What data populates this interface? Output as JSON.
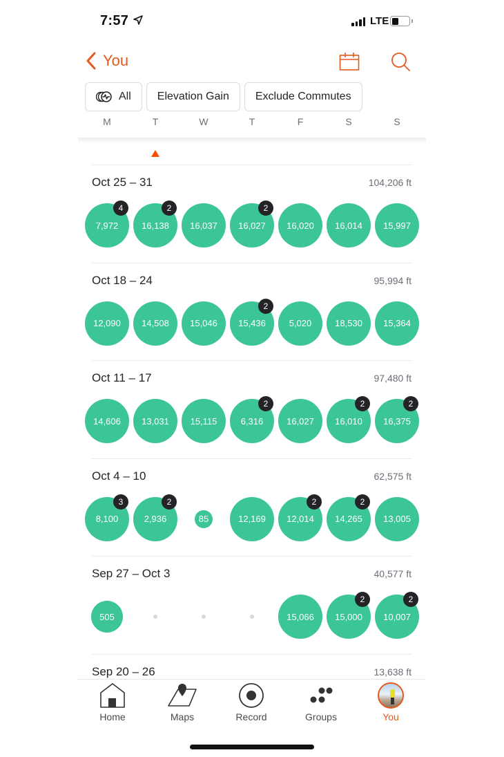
{
  "status_bar": {
    "time": "7:57",
    "network": "LTE",
    "battery_percent": 30
  },
  "nav": {
    "back_label": "You",
    "icons": [
      "chevron-left-icon",
      "calendar-icon",
      "search-icon"
    ]
  },
  "filters": [
    {
      "label": "All",
      "icon": "sport-types-icon"
    },
    {
      "label": "Elevation Gain"
    },
    {
      "label": "Exclude Commutes"
    }
  ],
  "days": [
    "M",
    "T",
    "W",
    "T",
    "F",
    "S",
    "S"
  ],
  "today_index": 1,
  "colors": {
    "accent": "#fc4c02",
    "activity": "#3cc597",
    "badge": "#242428"
  },
  "unit": "ft",
  "weeks": [
    {
      "range": "Oct 25 – 31",
      "total": "104,206 ft",
      "days": [
        {
          "value": "7,972",
          "count": "4"
        },
        {
          "value": "16,138",
          "count": "2"
        },
        {
          "value": "16,037"
        },
        {
          "value": "16,027",
          "count": "2"
        },
        {
          "value": "16,020"
        },
        {
          "value": "16,014"
        },
        {
          "value": "15,997"
        }
      ]
    },
    {
      "range": "Oct 18 – 24",
      "total": "95,994 ft",
      "days": [
        {
          "value": "12,090"
        },
        {
          "value": "14,508"
        },
        {
          "value": "15,046"
        },
        {
          "value": "15,436",
          "count": "2"
        },
        {
          "value": "5,020"
        },
        {
          "value": "18,530"
        },
        {
          "value": "15,364"
        }
      ]
    },
    {
      "range": "Oct 11 – 17",
      "total": "97,480 ft",
      "days": [
        {
          "value": "14,606"
        },
        {
          "value": "13,031"
        },
        {
          "value": "15,115"
        },
        {
          "value": "6,316",
          "count": "2"
        },
        {
          "value": "16,027"
        },
        {
          "value": "16,010",
          "count": "2"
        },
        {
          "value": "16,375",
          "count": "2"
        }
      ]
    },
    {
      "range": "Oct 4 – 10",
      "total": "62,575 ft",
      "days": [
        {
          "value": "8,100",
          "count": "3"
        },
        {
          "value": "2,936",
          "count": "2"
        },
        {
          "value": "85",
          "size": "small"
        },
        {
          "value": "12,169"
        },
        {
          "value": "12,014",
          "count": "2"
        },
        {
          "value": "14,265",
          "count": "2"
        },
        {
          "value": "13,005"
        }
      ]
    },
    {
      "range": "Sep 27 – Oct 3",
      "total": "40,577 ft",
      "days": [
        {
          "value": "505",
          "size": "medium"
        },
        {
          "value": null
        },
        {
          "value": null
        },
        {
          "value": null
        },
        {
          "value": "15,066"
        },
        {
          "value": "15,000",
          "count": "2"
        },
        {
          "value": "10,007",
          "count": "2"
        }
      ]
    },
    {
      "range": "Sep 20 – 26",
      "total": "13,638 ft",
      "days": []
    }
  ],
  "tabbar": [
    {
      "label": "Home",
      "icon": "home-icon"
    },
    {
      "label": "Maps",
      "icon": "maps-icon"
    },
    {
      "label": "Record",
      "icon": "record-icon"
    },
    {
      "label": "Groups",
      "icon": "groups-icon"
    },
    {
      "label": "You",
      "icon": "avatar",
      "active": true
    }
  ]
}
